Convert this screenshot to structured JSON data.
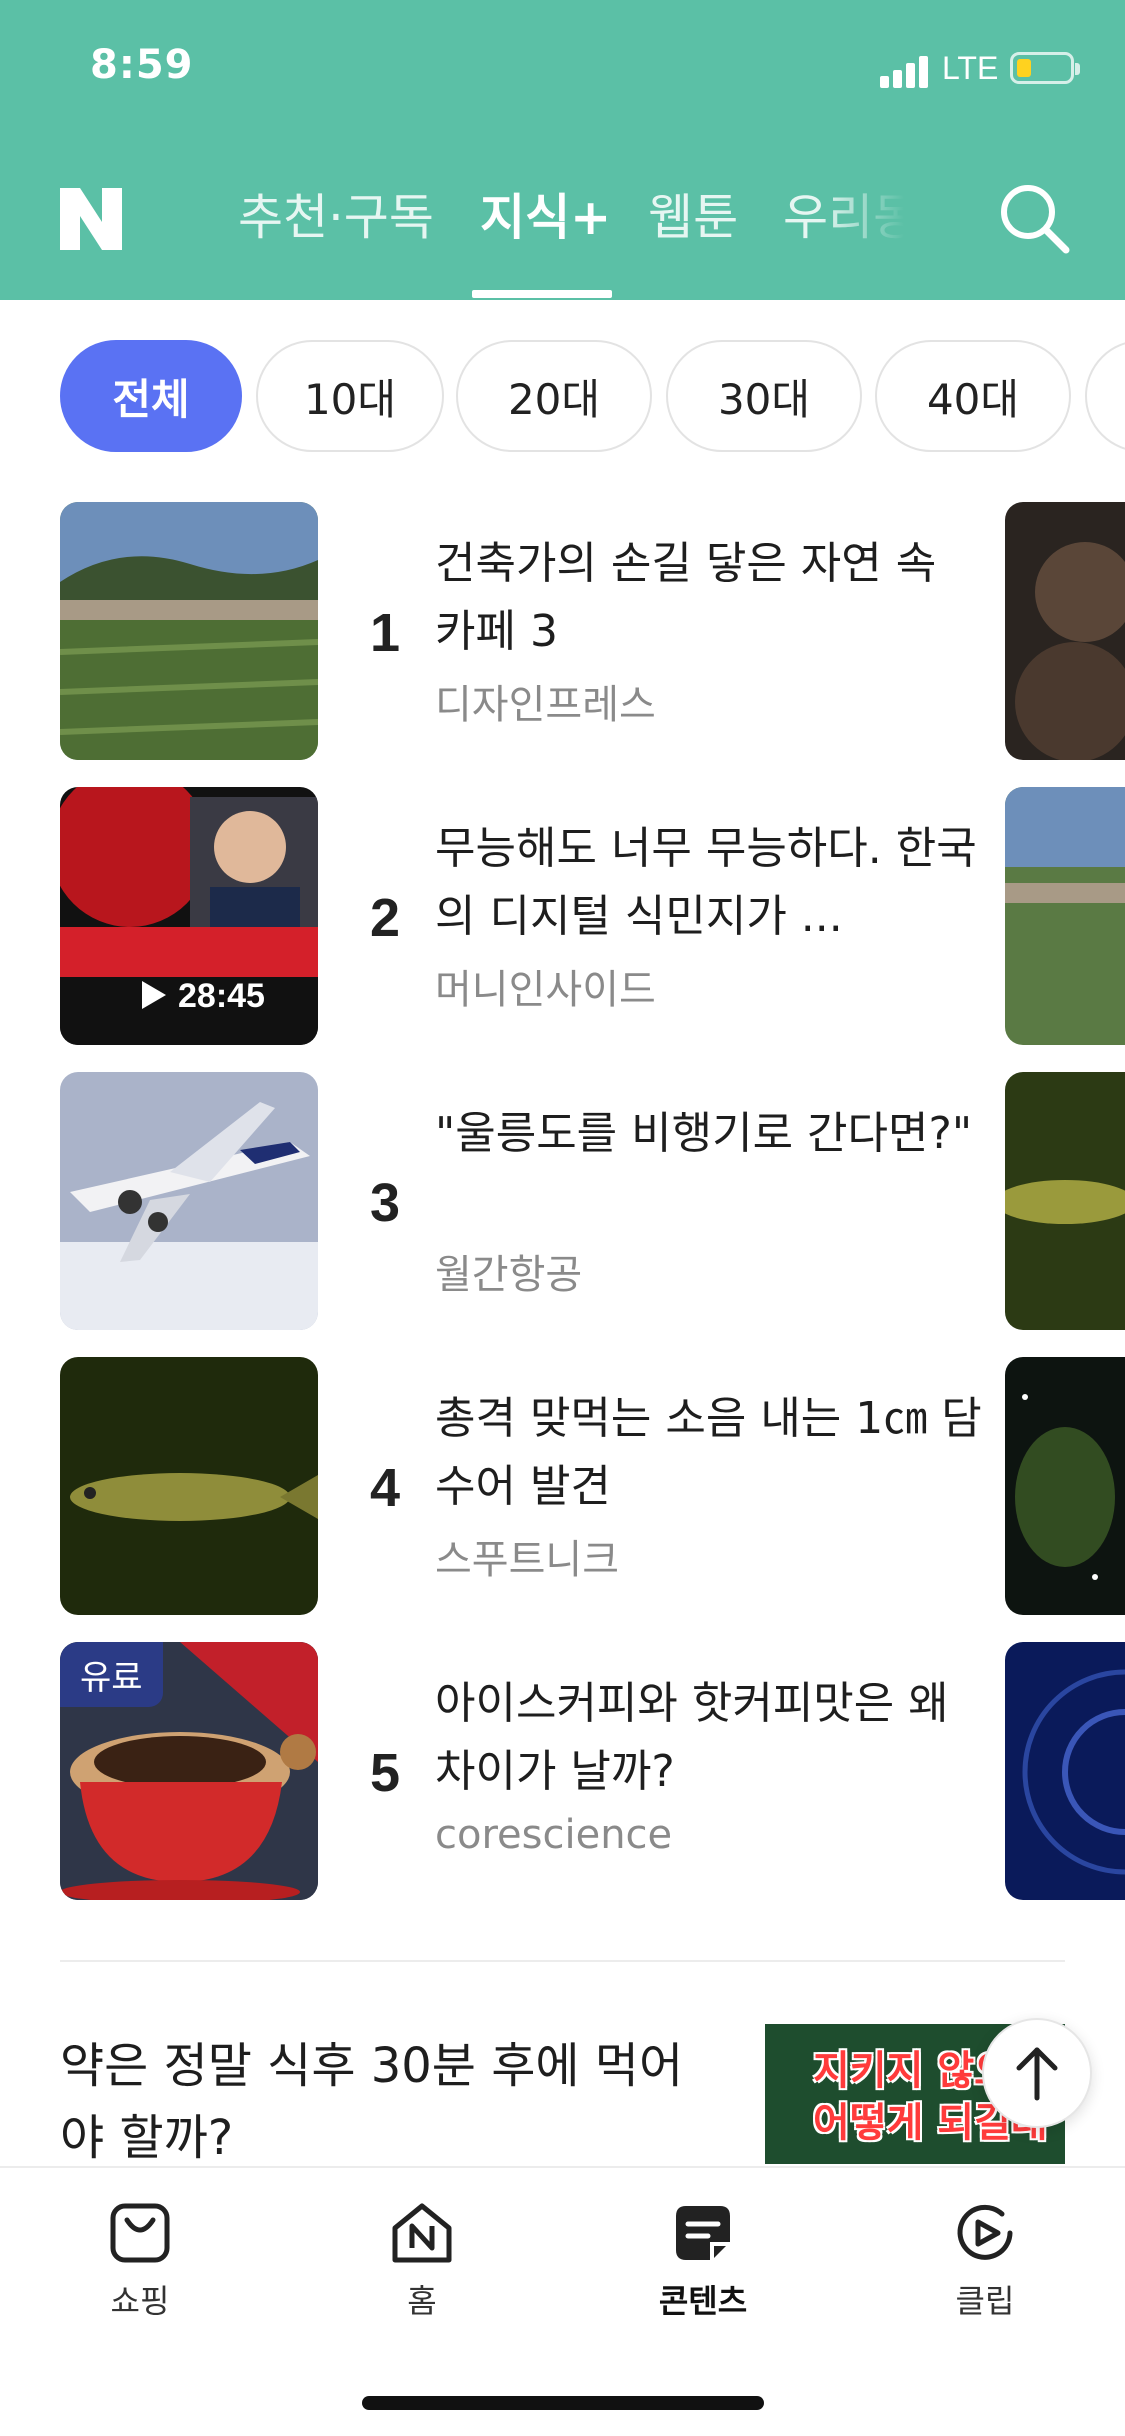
{
  "status_bar": {
    "time": "8:59",
    "network": "LTE"
  },
  "header": {
    "logo": "N",
    "tabs": [
      {
        "label": "추천·구독",
        "active": false
      },
      {
        "label": "지식+",
        "active": true
      },
      {
        "label": "웹툰",
        "active": false
      },
      {
        "label": "우리동",
        "active": false
      }
    ],
    "search_icon": "search-icon",
    "background_color": "#5bc0a6"
  },
  "age_filters": [
    {
      "label": "전체",
      "active": true
    },
    {
      "label": "10대",
      "active": false
    },
    {
      "label": "20대",
      "active": false
    },
    {
      "label": "30대",
      "active": false
    },
    {
      "label": "40대",
      "active": false
    }
  ],
  "accent_color": "#5a72f3",
  "ranking": [
    {
      "rank": "1",
      "title": "건축가의 손길 닿은 자연 속 카페 3",
      "source": "디자인프레스"
    },
    {
      "rank": "2",
      "title": "무능해도 너무 무능하다. 한국의 디지털 식민지가 ...",
      "source": "머니인사이드",
      "video_duration": "28:45"
    },
    {
      "rank": "3",
      "title": "\"울릉도를 비행기로 간다면?\"",
      "source": "월간항공"
    },
    {
      "rank": "4",
      "title": "총격 맞먹는 소음 내는 1㎝ 담수어 발견",
      "source": "스푸트니크"
    },
    {
      "rank": "5",
      "title": "아이스커피와 핫커피맛은 왜 차이가 날까?",
      "source": "corescience",
      "badge": "유료"
    }
  ],
  "article": {
    "title": "약은 정말 식후 30분 후에 먹어야 할까?",
    "thumb_text_1": "지키지 않으",
    "thumb_text_2": "어떻게 되길래"
  },
  "bottom_tabs": [
    {
      "label": "쇼핑",
      "icon": "shopping-bag-icon",
      "active": false
    },
    {
      "label": "홈",
      "icon": "home-icon",
      "active": false
    },
    {
      "label": "콘텐츠",
      "icon": "content-icon",
      "active": true
    },
    {
      "label": "클립",
      "icon": "clip-play-icon",
      "active": false
    }
  ]
}
